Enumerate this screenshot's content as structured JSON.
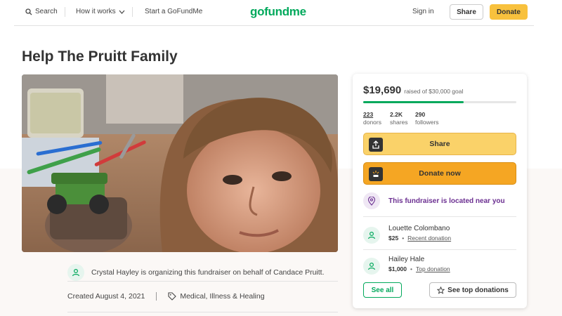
{
  "header": {
    "search_label": "Search",
    "how_it_works_label": "How it works",
    "start_label": "Start a GoFundMe",
    "logo_text": "gofundme",
    "sign_in_label": "Sign in",
    "share_label": "Share",
    "donate_label": "Donate"
  },
  "page": {
    "title": "Help The Pruitt Family"
  },
  "organizer": {
    "text": "Crystal Hayley is organizing this fundraiser on behalf of Candace Pruitt."
  },
  "meta": {
    "created": "Created August 4, 2021",
    "category": "Medical, Illness & Healing"
  },
  "sidebar": {
    "raised_amount": "$19,690",
    "raised_goal": "raised of $30,000 goal",
    "progress_fraction": 0.656,
    "stats": [
      {
        "value": "223",
        "label": "donors"
      },
      {
        "value": "2.2K",
        "label": "shares"
      },
      {
        "value": "290",
        "label": "followers"
      }
    ],
    "share_button": "Share",
    "donate_button": "Donate now",
    "near_you": "This fundraiser is located near you",
    "donations": [
      {
        "name": "Louette Colombano",
        "amount": "$25",
        "kind": "Recent donation"
      },
      {
        "name": "Hailey Hale",
        "amount": "$1,000",
        "kind": "Top donation"
      }
    ],
    "see_all": "See all",
    "see_top": "See top donations"
  },
  "colors": {
    "brand_green": "#02a95c",
    "donate_yellow": "#f8c13d",
    "donate_orange": "#f5a623",
    "near_purple": "#6b2f91"
  },
  "icons": {
    "search": "search-icon",
    "chevron": "chevron-down-icon",
    "share": "share-icon",
    "donate": "donate-icon",
    "pin": "location-pin-icon",
    "avatar": "user-avatar-icon",
    "tag": "tag-icon",
    "star": "star-icon"
  }
}
